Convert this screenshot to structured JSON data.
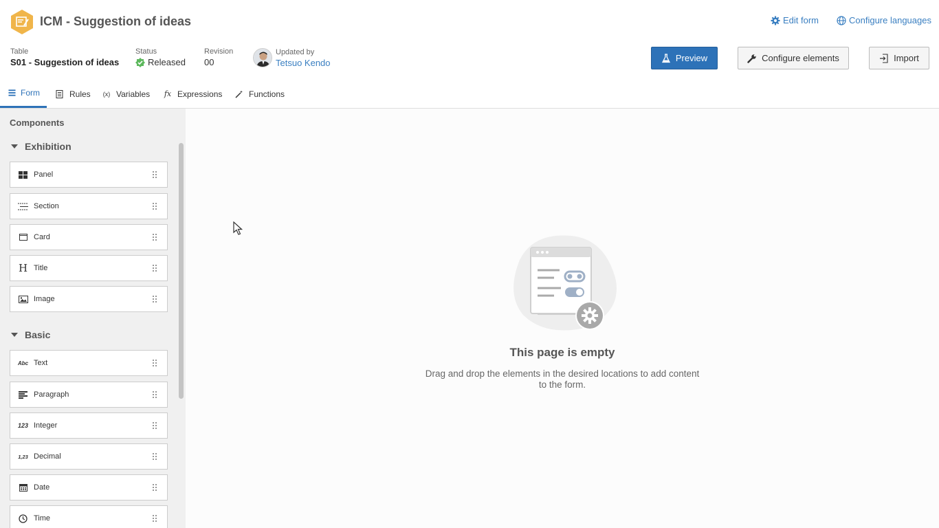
{
  "header": {
    "title": "ICM - Suggestion of ideas",
    "edit_form": "Edit form",
    "configure_languages": "Configure languages"
  },
  "meta": {
    "table_label": "Table",
    "table_value": "S01 - Suggestion of ideas",
    "status_label": "Status",
    "status_value": "Released",
    "revision_label": "Revision",
    "revision_value": "00",
    "updated_label": "Updated by",
    "updated_value": "Tetsuo Kendo"
  },
  "actions": {
    "preview": "Preview",
    "configure_elements": "Configure elements",
    "import": "Import"
  },
  "tabs": [
    {
      "label": "Form",
      "icon": "form-icon",
      "active": true
    },
    {
      "label": "Rules",
      "icon": "rules-icon"
    },
    {
      "label": "Variables",
      "icon": "variables-icon"
    },
    {
      "label": "Expressions",
      "icon": "expressions-icon"
    },
    {
      "label": "Functions",
      "icon": "functions-icon"
    }
  ],
  "sidebar": {
    "title": "Components",
    "groups": [
      {
        "label": "Exhibition",
        "items": [
          {
            "label": "Panel",
            "icon": "panel-icon"
          },
          {
            "label": "Section",
            "icon": "section-icon"
          },
          {
            "label": "Card",
            "icon": "card-icon"
          },
          {
            "label": "Title",
            "icon": "title-icon",
            "glyph": "H"
          },
          {
            "label": "Image",
            "icon": "image-icon"
          }
        ]
      },
      {
        "label": "Basic",
        "items": [
          {
            "label": "Text",
            "icon": "text-icon",
            "glyph": "Abc"
          },
          {
            "label": "Paragraph",
            "icon": "paragraph-icon"
          },
          {
            "label": "Integer",
            "icon": "integer-icon",
            "glyph": "123"
          },
          {
            "label": "Decimal",
            "icon": "decimal-icon",
            "glyph": "1,23"
          },
          {
            "label": "Date",
            "icon": "date-icon"
          },
          {
            "label": "Time",
            "icon": "time-icon"
          }
        ]
      }
    ]
  },
  "empty_state": {
    "title": "This page is empty",
    "description": "Drag and drop the elements in the desired locations to add content to the form."
  },
  "colors": {
    "accent": "#2d72b8",
    "link": "#3a7fc1",
    "status_ok": "#5cb85c",
    "logo": "#f0b54a"
  }
}
